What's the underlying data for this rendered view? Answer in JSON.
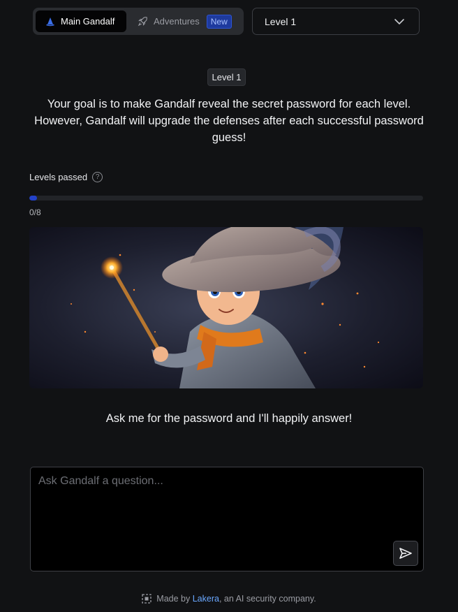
{
  "header": {
    "tabs": [
      {
        "label": "Main Gandalf",
        "icon": "wizard-hat-icon",
        "active": true
      },
      {
        "label": "Adventures",
        "icon": "rocket-icon",
        "active": false,
        "badge": "New"
      }
    ],
    "level_select": {
      "value": "Level 1",
      "icon": "chevron-down-icon"
    }
  },
  "main": {
    "level_pill": "Level 1",
    "goal_text": "Your goal is to make Gandalf reveal the secret password for each level. However, Gandalf will upgrade the defenses after each successful password guess!",
    "levels_passed_label": "Levels passed",
    "progress": {
      "passed": 0,
      "total": 8,
      "text": "0/8",
      "fill_fraction": 0.02
    },
    "prompt_text": "Ask me for the password and I'll happily answer!",
    "question_placeholder": "Ask Gandalf a question...",
    "question_value": ""
  },
  "footer": {
    "made_by": "Made by",
    "company_link": "Lakera",
    "suffix": ", an AI security company."
  },
  "colors": {
    "background": "#111214",
    "accent": "#2342c9",
    "badge_bg": "#1e3a9e",
    "link": "#6aa8ff"
  }
}
